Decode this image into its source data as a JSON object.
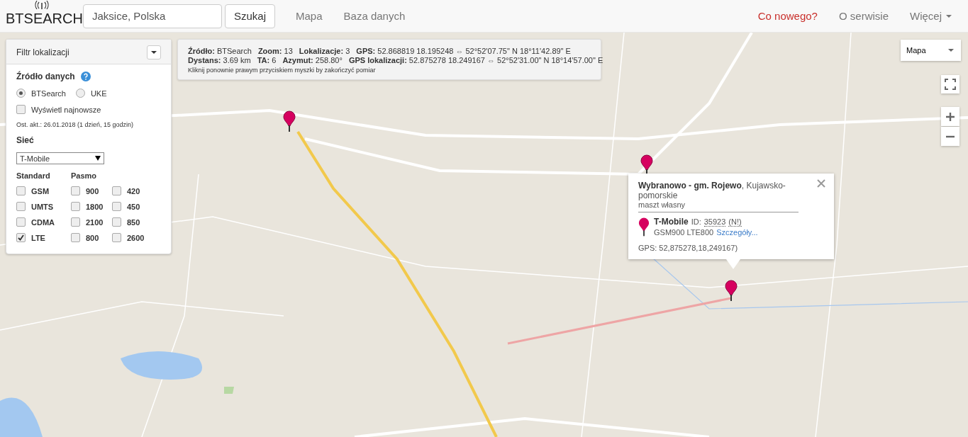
{
  "header": {
    "logo": "BTSEARCH",
    "search": {
      "value": "Jaksice, Polska"
    },
    "search_button": "Szukaj",
    "nav": [
      {
        "label": "Mapa",
        "kind": "link"
      },
      {
        "label": "Baza danych",
        "kind": "link"
      }
    ],
    "nav_right": [
      {
        "label": "Co nowego?",
        "kind": "highlight"
      },
      {
        "label": "O serwisie",
        "kind": "link"
      },
      {
        "label": "Więcej",
        "kind": "dropdown"
      }
    ]
  },
  "filter": {
    "title": "Filtr lokalizacji",
    "data_source_label": "Źródło danych",
    "sources": [
      {
        "label": "BTSearch",
        "selected": true
      },
      {
        "label": "UKE",
        "selected": false
      }
    ],
    "newest": {
      "label": "Wyświetl najnowsze",
      "checked": false
    },
    "last_update": "Ost. akt.: 26.01.2018 (1 dzień, 15 godzin)",
    "network_label": "Sieć",
    "network": "T-Mobile",
    "standard_label": "Standard",
    "band_label": "Pasmo",
    "standards": [
      {
        "label": "GSM",
        "checked": false
      },
      {
        "label": "UMTS",
        "checked": false
      },
      {
        "label": "CDMA",
        "checked": false
      },
      {
        "label": "LTE",
        "checked": true
      }
    ],
    "bands": [
      {
        "label": "900",
        "checked": false
      },
      {
        "label": "420",
        "checked": false
      },
      {
        "label": "1800",
        "checked": false
      },
      {
        "label": "450",
        "checked": false
      },
      {
        "label": "2100",
        "checked": false
      },
      {
        "label": "850",
        "checked": false
      },
      {
        "label": "800",
        "checked": false
      },
      {
        "label": "2600",
        "checked": false
      }
    ]
  },
  "info": {
    "lines": [
      [
        {
          "label": "Źródło:",
          "value": "BTSearch"
        },
        {
          "label": "Zoom:",
          "value": "13"
        },
        {
          "label": "Lokalizacje:",
          "value": "3"
        },
        {
          "label": "GPS:",
          "value": "52.868819 18.195248 ⇔ 52°52'07.75\" N 18°11'42.89\" E"
        }
      ],
      [
        {
          "label": "Dystans:",
          "value": "3.69 km"
        },
        {
          "label": "TA:",
          "value": "6"
        },
        {
          "label": "Azymut:",
          "value": "258.80°"
        },
        {
          "label": "GPS lokalizacji:",
          "value": "52.875278 18.249167 ⇔ 52°52'31.00\" N 18°14'57.00\" E"
        }
      ]
    ],
    "hint": "Kliknij ponownie prawym przyciskiem myszki by zakończyć pomiar"
  },
  "popup": {
    "title": "**Wybranowo - gm. Rojewo**, Kujawsko-pomorskie",
    "subtitle": "maszt własny",
    "operator": "T-Mobile",
    "id_label": "ID:",
    "id": "35923",
    "flag": "(N!)",
    "tech": "GSM900 LTE800",
    "link": "Szczegóły...",
    "gps": "GPS: 52,875278,18,249167)"
  },
  "map_type": "Mapa"
}
